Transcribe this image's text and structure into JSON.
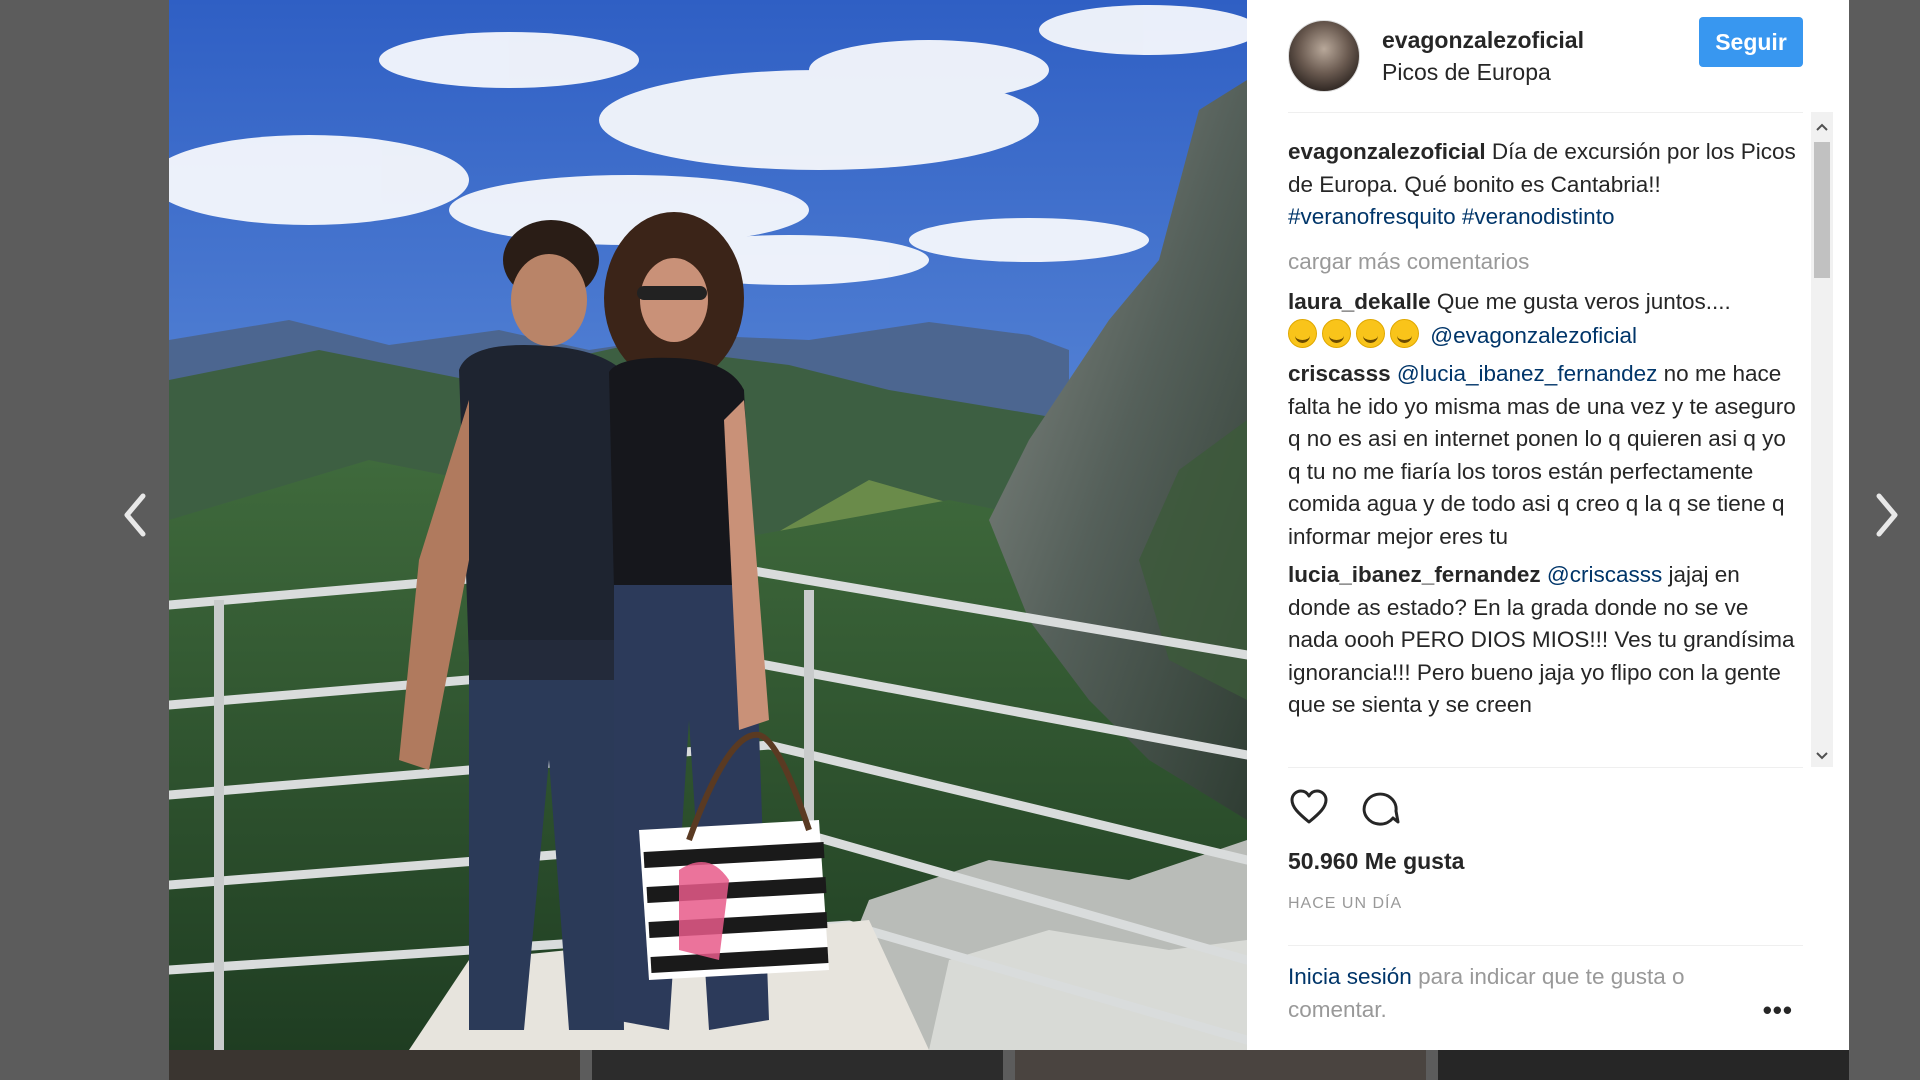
{
  "post": {
    "username": "evagonzalezoficial",
    "location": "Picos de Europa",
    "follow_label": "Seguir"
  },
  "caption": {
    "username": "evagonzalezoficial",
    "text": "Día de excursión por los Picos de Europa. Qué bonito es Cantabria!! ",
    "tags": "#veranofresquito #veranodistinto"
  },
  "load_more_label": "cargar más comentarios",
  "comments": [
    {
      "username": "laura_dekalle",
      "text": "Que me gusta veros juntos....",
      "mention": "@evagonzalezoficial"
    },
    {
      "username": "criscasss",
      "mention": "@lucia_ibanez_fernandez",
      "text": "no me hace falta he ido yo misma mas de una vez y te aseguro q no es asi en internet ponen lo q quieren asi q yo q tu no me fiaría los toros están perfectamente comida agua y de todo asi q creo q la q se tiene q informar mejor eres tu"
    },
    {
      "username": "lucia_ibanez_fernandez",
      "mention": "@criscasss",
      "text": "jajaj en donde as estado? En la grada donde no se ve nada oooh PERO DIOS MIOS!!! Ves tu grandísima ignorancia!!! Pero bueno jaja yo flipo con la gente que se sienta y se creen"
    }
  ],
  "likes": "50.960 Me gusta",
  "timestamp": "HACE UN DÍA",
  "login": {
    "link": "Inicia sesión",
    "text": " para indicar que te gusta o comentar."
  },
  "more_label": "•••",
  "icons": {
    "like": "heart-outline-icon",
    "comment": "speech-bubble-icon",
    "prev": "chevron-left-icon",
    "next": "chevron-right-icon"
  },
  "colors": {
    "follow_button": "#3897f0",
    "link": "#003569",
    "muted": "#999999"
  }
}
